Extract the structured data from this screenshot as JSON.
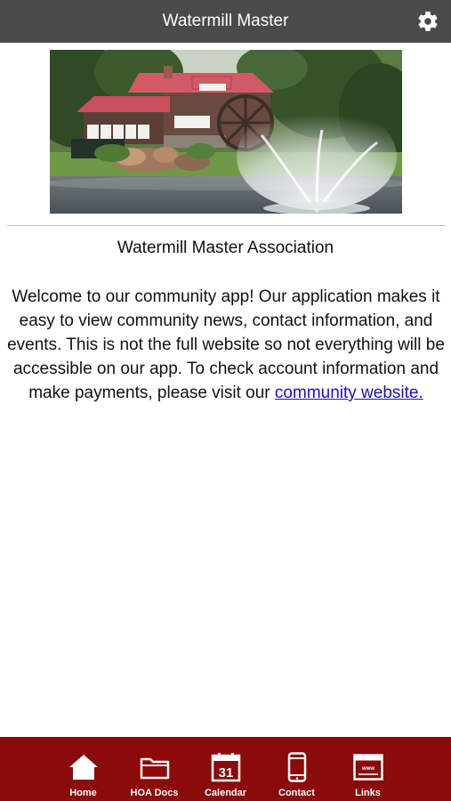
{
  "header": {
    "title": "Watermill Master",
    "settings_icon": "gear-icon"
  },
  "main": {
    "association_title": "Watermill Master Association",
    "intro_text": "Welcome to our community app! Our application makes it easy to view community news, contact information, and events. This is not the full website so not everything will be accessible on our app. To check account information and make payments, please visit our ",
    "intro_link_text": "community website."
  },
  "tabbar": {
    "background": "#8b0a0a",
    "items": [
      {
        "label": "Home",
        "icon": "home-icon"
      },
      {
        "label": "HOA Docs",
        "icon": "folder-icon"
      },
      {
        "label": "Calendar",
        "icon": "calendar-icon",
        "icon_text": "31"
      },
      {
        "label": "Contact",
        "icon": "phone-icon"
      },
      {
        "label": "Links",
        "icon": "browser-icon",
        "icon_text": "www"
      }
    ]
  },
  "colors": {
    "header_bg": "#4a4a4a",
    "link": "#1a0dcc"
  }
}
